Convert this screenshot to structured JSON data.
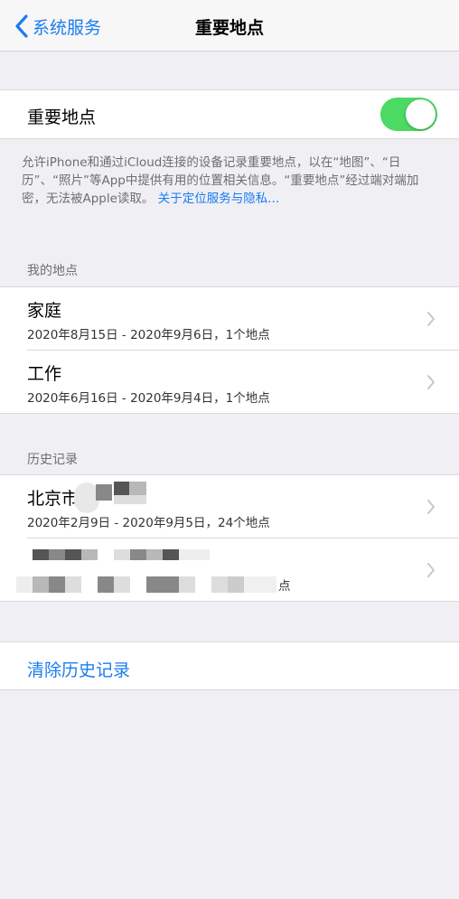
{
  "navbar": {
    "back_label": "系统服务",
    "title": "重要地点"
  },
  "toggle_section": {
    "label": "重要地点",
    "enabled": true
  },
  "footnote": {
    "text": "允许iPhone和通过iCloud连接的设备记录重要地点，以在“地图”、“日历”、“照片”等App中提供有用的位置相关信息。“重要地点”经过端对端加密，无法被Apple读取。",
    "link": "关于定位服务与隐私..."
  },
  "my_places": {
    "header": "我的地点",
    "items": [
      {
        "title": "家庭",
        "subtitle": "2020年8月15日 - 2020年9月6日，1个地点"
      },
      {
        "title": "工作",
        "subtitle": "2020年6月16日 - 2020年9月4日，1个地点"
      }
    ]
  },
  "history": {
    "header": "历史记录",
    "items": [
      {
        "title": "北京市",
        "subtitle": "2020年2月9日 - 2020年9月5日，24个地点"
      },
      {
        "title": "",
        "subtitle": "点"
      }
    ]
  },
  "clear_history": {
    "label": "清除历史记录"
  },
  "colors": {
    "accent": "#1b7cf0",
    "toggle_on": "#4cd964",
    "background": "#efeff4"
  }
}
